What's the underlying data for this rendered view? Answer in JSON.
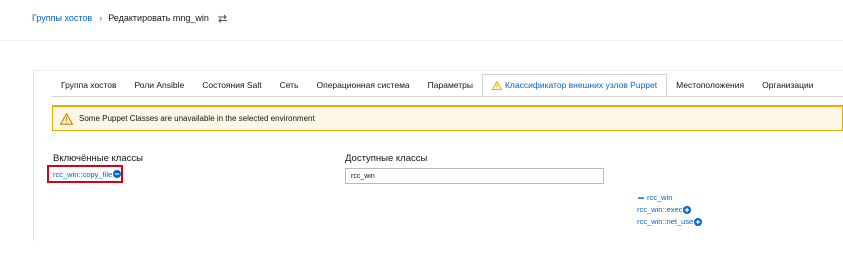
{
  "breadcrumb": {
    "parent": "Группы хостов",
    "separator": "›",
    "current": "Редактировать mng_win"
  },
  "tabs": [
    {
      "label": "Группа хостов"
    },
    {
      "label": "Роли Ansible"
    },
    {
      "label": "Состояния Salt"
    },
    {
      "label": "Сеть"
    },
    {
      "label": "Операционная система"
    },
    {
      "label": "Параметры"
    },
    {
      "label": "Классификатор внешних узлов Puppet",
      "active": true
    },
    {
      "label": "Местоположения"
    },
    {
      "label": "Организации"
    }
  ],
  "alert": {
    "text": "Some Puppet Classes are unavailable in the selected environment"
  },
  "included": {
    "title": "Включённые классы",
    "items": [
      "rcc_win::copy_file"
    ]
  },
  "available": {
    "title": "Доступные классы",
    "filter_value": "rcc_win",
    "group": "rcc_win",
    "items": [
      "rcc_win::exec",
      "rcc_win::net_use"
    ]
  },
  "colors": {
    "link": "#0066cc",
    "warning": "#f0ab00",
    "warning_bg": "#fdf7e7",
    "highlight_border": "#d9001b"
  },
  "icons": {
    "switch": "switch-icon",
    "warning": "warning-icon",
    "remove": "minus-circle-icon",
    "add": "plus-circle-icon"
  }
}
